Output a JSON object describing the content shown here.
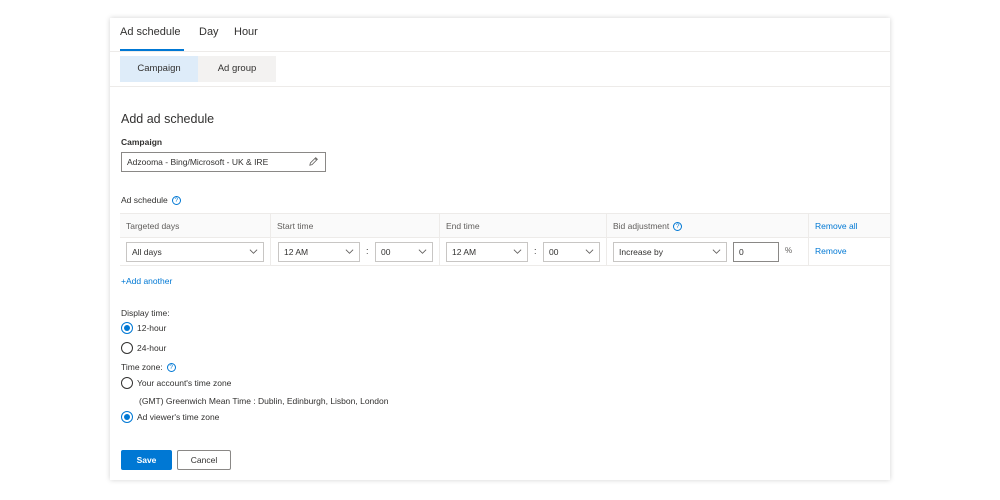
{
  "tabs": [
    {
      "label": "Ad schedule"
    },
    {
      "label": "Day"
    },
    {
      "label": "Hour"
    }
  ],
  "subtabs": [
    {
      "label": "Campaign"
    },
    {
      "label": "Ad group"
    }
  ],
  "form": {
    "title": "Add ad schedule",
    "campaign_label": "Campaign",
    "campaign_value": "Adzooma - Bing/Microsoft - UK & IRE",
    "ad_schedule_label": "Ad schedule",
    "help_glyph": "?"
  },
  "table": {
    "headers": {
      "targeted_days": "Targeted days",
      "start_time": "Start time",
      "end_time": "End time",
      "bid_adjustment": "Bid adjustment",
      "remove_all": "Remove all"
    },
    "row": {
      "days": "All days",
      "start_hour": "12 AM",
      "start_min": "00",
      "end_hour": "12 AM",
      "end_min": "00",
      "adjust_type": "Increase by",
      "adjust_value": "0",
      "percent": "%",
      "remove": "Remove",
      "colon": ":"
    },
    "add_another": "+Add another"
  },
  "display_time": {
    "label": "Display time:",
    "options": [
      {
        "label": "12-hour",
        "selected": true
      },
      {
        "label": "24-hour",
        "selected": false
      }
    ]
  },
  "time_zone": {
    "label": "Time zone:",
    "options": [
      {
        "label": "Your account's time zone",
        "selected": false
      },
      {
        "label": "Ad viewer's time zone",
        "selected": true
      }
    ],
    "account_zone_detail": "(GMT) Greenwich Mean Time : Dublin, Edinburgh, Lisbon, London"
  },
  "buttons": {
    "save": "Save",
    "cancel": "Cancel"
  },
  "colors": {
    "accent": "#0078d4",
    "active_subtab_bg": "#deecf9"
  }
}
